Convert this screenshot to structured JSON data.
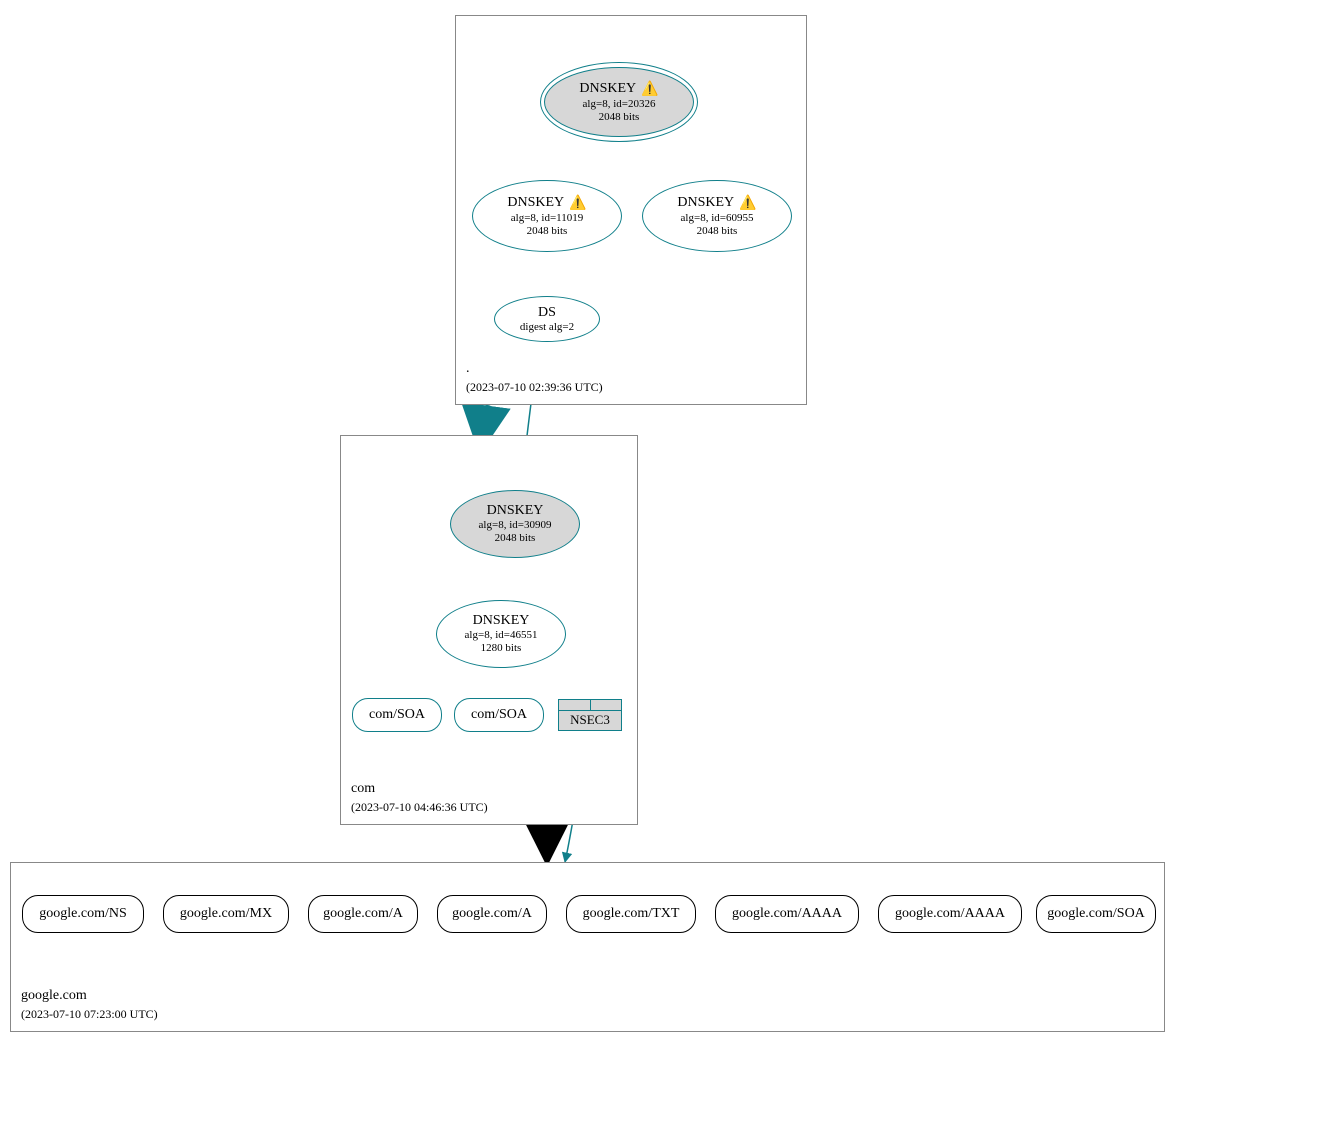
{
  "colors": {
    "teal": "#107f8a",
    "black": "#000000",
    "zone_border": "#888888",
    "node_fill_grey": "#d7d7d7"
  },
  "icons": {
    "warning": "⚠️"
  },
  "zones": {
    "root": {
      "name": ".",
      "timestamp": "(2023-07-10 02:39:36 UTC)"
    },
    "com": {
      "name": "com",
      "timestamp": "(2023-07-10 04:46:36 UTC)"
    },
    "google": {
      "name": "google.com",
      "timestamp": "(2023-07-10 07:23:00 UTC)"
    }
  },
  "nodes": {
    "root_ksk": {
      "title": "DNSKEY",
      "warning": true,
      "detail1": "alg=8, id=20326",
      "detail2": "2048 bits"
    },
    "root_zsk1": {
      "title": "DNSKEY",
      "warning": true,
      "detail1": "alg=8, id=11019",
      "detail2": "2048 bits"
    },
    "root_zsk2": {
      "title": "DNSKEY",
      "warning": true,
      "detail1": "alg=8, id=60955",
      "detail2": "2048 bits"
    },
    "root_ds": {
      "title": "DS",
      "detail1": "digest alg=2"
    },
    "com_ksk": {
      "title": "DNSKEY",
      "detail1": "alg=8, id=30909",
      "detail2": "2048 bits"
    },
    "com_zsk": {
      "title": "DNSKEY",
      "detail1": "alg=8, id=46551",
      "detail2": "1280 bits"
    },
    "com_soa1": {
      "label": "com/SOA"
    },
    "com_soa2": {
      "label": "com/SOA"
    },
    "com_nsec3": {
      "label": "NSEC3"
    },
    "g_ns": {
      "label": "google.com/NS"
    },
    "g_mx": {
      "label": "google.com/MX"
    },
    "g_a1": {
      "label": "google.com/A"
    },
    "g_a2": {
      "label": "google.com/A"
    },
    "g_txt": {
      "label": "google.com/TXT"
    },
    "g_aaaa1": {
      "label": "google.com/AAAA"
    },
    "g_aaaa2": {
      "label": "google.com/AAAA"
    },
    "g_soa": {
      "label": "google.com/SOA"
    }
  }
}
